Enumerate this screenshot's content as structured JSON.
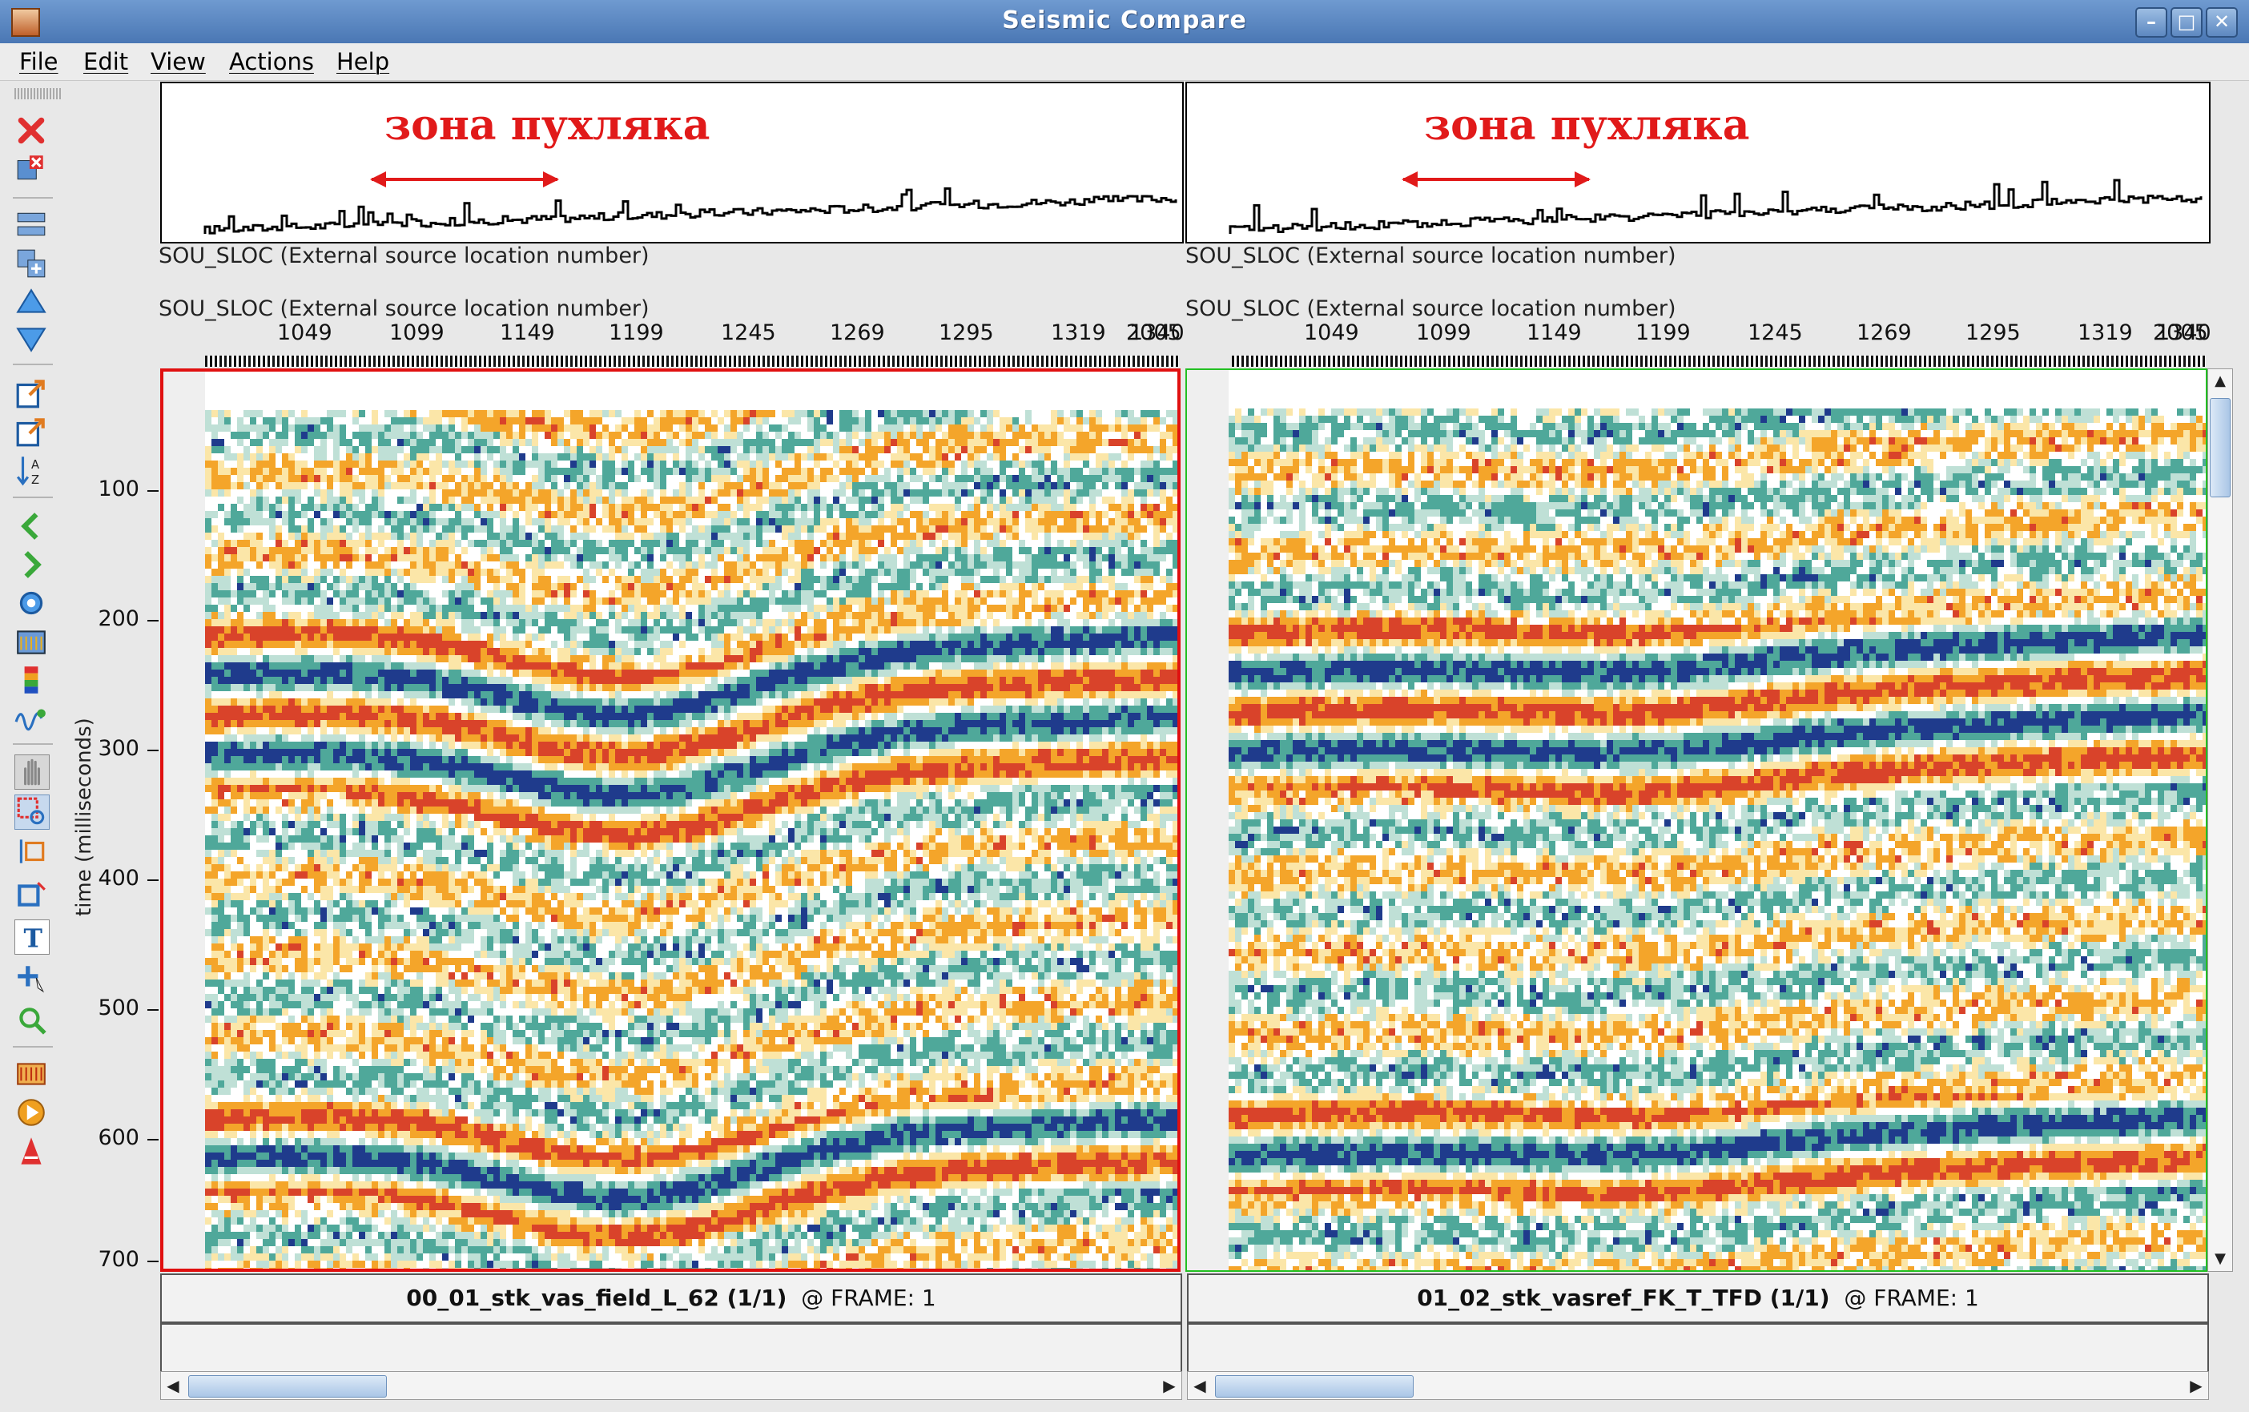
{
  "window": {
    "title": "Seismic Compare",
    "minimize": "–",
    "maximize": "□",
    "close": "✕"
  },
  "menu": [
    "File",
    "Edit",
    "View",
    "Actions",
    "Help"
  ],
  "toolbar_icons": [
    "close-icon",
    "close-panel-icon",
    "layout-icon",
    "add-panel-icon",
    "move-up-icon",
    "move-down-icon",
    "export-icon",
    "export-alt-icon",
    "sort-icon",
    "previous-icon",
    "next-icon",
    "settings-icon",
    "display-icon",
    "colorbar-icon",
    "wiggle-icon",
    "pan-hand-icon",
    "zoom-box-icon",
    "pick-icon",
    "rubberband-icon",
    "text-tool-icon",
    "add-point-icon",
    "zoom-fit-icon",
    "spectrum-icon",
    "play-icon",
    "attribute-icon"
  ],
  "panels": [
    {
      "annotation": "зона пухляка",
      "header_label": "SOU_SLOC (External source location number)",
      "axis_label": "SOU_SLOC (External source location number)",
      "ticks": [
        "1049",
        "1099",
        "1149",
        "1199",
        "1245",
        "1269",
        "1295",
        "1319",
        "2005",
        "1340"
      ],
      "status_name": "00_01_stk_vas_field_L_62 (1/1)",
      "status_frame": "@  FRAME: 1",
      "border_color": "#e01010"
    },
    {
      "annotation": "зона пухляка",
      "header_label": "SOU_SLOC (External source location number)",
      "axis_label": "SOU_SLOC (External source location number)",
      "ticks": [
        "1049",
        "1099",
        "1149",
        "1199",
        "1245",
        "1269",
        "1295",
        "1319",
        "2005",
        "1340"
      ],
      "status_name": "01_02_stk_vasref_FK_T_TFD (1/1)",
      "status_frame": "@  FRAME: 1",
      "border_color": "#22c022"
    }
  ],
  "y_axis": {
    "title": "time (milliseconds)",
    "ticks": [
      "100",
      "200",
      "300",
      "400",
      "500",
      "600",
      "700"
    ]
  },
  "colors": {
    "red": "#d9432a",
    "blue": "#1f3b8c",
    "orange": "#f4a52a",
    "teal": "#4fa89a"
  }
}
